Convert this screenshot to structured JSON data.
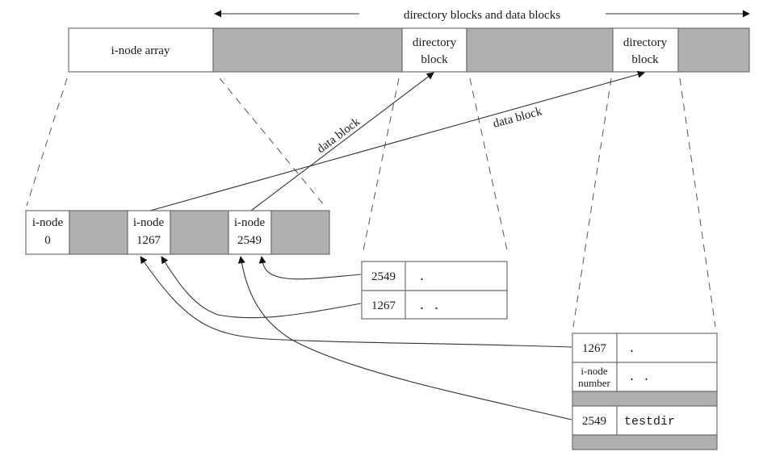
{
  "header": {
    "span_label": "directory blocks and data blocks"
  },
  "disk_strip": {
    "segments": [
      {
        "label": "i-node array",
        "shaded": false
      },
      {
        "label": "",
        "shaded": true
      },
      {
        "label_line1": "directory",
        "label_line2": "block",
        "shaded": false
      },
      {
        "label": "",
        "shaded": true
      },
      {
        "label_line1": "directory",
        "label_line2": "block",
        "shaded": false
      },
      {
        "label": "",
        "shaded": true
      }
    ]
  },
  "inode_array": {
    "cells": [
      {
        "line1": "i-node",
        "line2": "0",
        "shaded": false
      },
      {
        "shaded": true
      },
      {
        "line1": "i-node",
        "line2": "1267",
        "shaded": false
      },
      {
        "shaded": true
      },
      {
        "line1": "i-node",
        "line2": "2549",
        "shaded": false
      },
      {
        "shaded": true
      }
    ]
  },
  "arrows": {
    "data_block_label_1": "data block",
    "data_block_label_2": "data block"
  },
  "dir_block_2549": {
    "rows": [
      {
        "inode": "2549",
        "name": "."
      },
      {
        "inode": "1267",
        "name": ". ."
      }
    ]
  },
  "dir_block_1267": {
    "rows": [
      {
        "inode": "1267",
        "name": "."
      },
      {
        "inode_line1": "i-node",
        "inode_line2": "number",
        "name": ". ."
      },
      {
        "shaded": true
      },
      {
        "inode": "2549",
        "name": "testdir"
      },
      {
        "shaded": true
      }
    ]
  },
  "colors": {
    "shade": "#b0b0b0",
    "border": "#6e6e6e",
    "ink": "#1a1a1a"
  }
}
